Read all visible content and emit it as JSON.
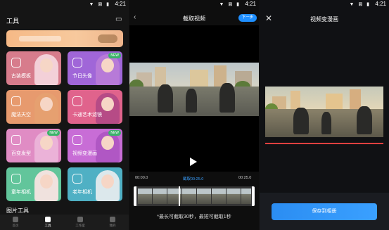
{
  "status": {
    "time": "4:21",
    "icons": "▼ ⊠ ▮"
  },
  "tools_screen": {
    "title": "工具",
    "cards": [
      {
        "label": "古装模板",
        "new": false,
        "color": "#d77c8c"
      },
      {
        "label": "节日头像",
        "new": true,
        "color": "#a066d8"
      },
      {
        "label": "魔法天空",
        "new": false,
        "color": "#e79a6e"
      },
      {
        "label": "卡通艺术滤镜",
        "new": false,
        "color": "#e0638c"
      },
      {
        "label": "百变发型",
        "new": true,
        "color": "#e08cc4"
      },
      {
        "label": "视频变漫画",
        "new": true,
        "color": "#c86dd6"
      },
      {
        "label": "童年相机",
        "new": false,
        "color": "#62c59b"
      },
      {
        "label": "老年相机",
        "new": false,
        "color": "#4fb0c4"
      }
    ],
    "new_tag": "NEW",
    "section_title": "图片工具",
    "tabs": [
      {
        "label": "首页",
        "active": false
      },
      {
        "label": "工具",
        "active": true
      },
      {
        "label": "工作室",
        "active": false
      },
      {
        "label": "我的",
        "active": false
      }
    ]
  },
  "trim_screen": {
    "title": "截取视频",
    "next_label": "下一步",
    "time_start": "00:00.0",
    "time_mid": "截取00:25.0",
    "time_end": "00:25.0",
    "hint": "*最长可截取30秒，最短可截取1秒"
  },
  "result_screen": {
    "title": "视频变漫画",
    "save_label": "保存到相册"
  },
  "colors": {
    "accent": "#1f8fff",
    "progress_red": "#e04040"
  }
}
